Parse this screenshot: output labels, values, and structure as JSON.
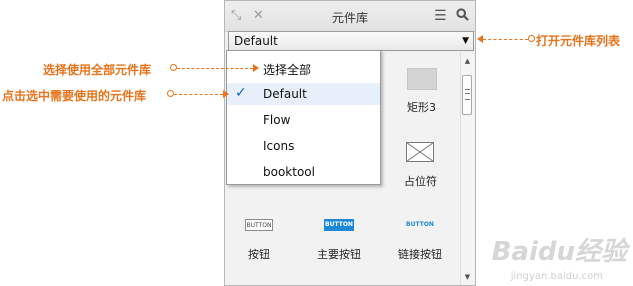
{
  "panel": {
    "title": "元件库",
    "titlebar_icons": [
      "collapse-icon",
      "close-icon",
      "menu-icon",
      "search-icon"
    ],
    "library_select": {
      "value": "Default"
    }
  },
  "widgets": [
    {
      "label": "矩形3"
    },
    {
      "label": "占位符"
    },
    {
      "label": "按钮",
      "preview": "BUTTON"
    },
    {
      "label": "主要按钮",
      "preview": "BUTTON"
    },
    {
      "label": "链接按钮",
      "preview": "BUTTON"
    }
  ],
  "library_menu": {
    "items": [
      "选择全部",
      "Default",
      "Flow",
      "Icons",
      "booktool"
    ],
    "checked": "Default"
  },
  "annotations": {
    "select_all": "选择使用全部元件库",
    "select_needed": "点击选中需要使用的元件库",
    "open_list": "打开元件库列表"
  },
  "watermark": {
    "main": "Baidu经验",
    "sub": "jingyan.baidu.com"
  },
  "colors": {
    "annotation": "#e8731a",
    "primary_button": "#1e88d8",
    "check": "#1a5fb4"
  }
}
